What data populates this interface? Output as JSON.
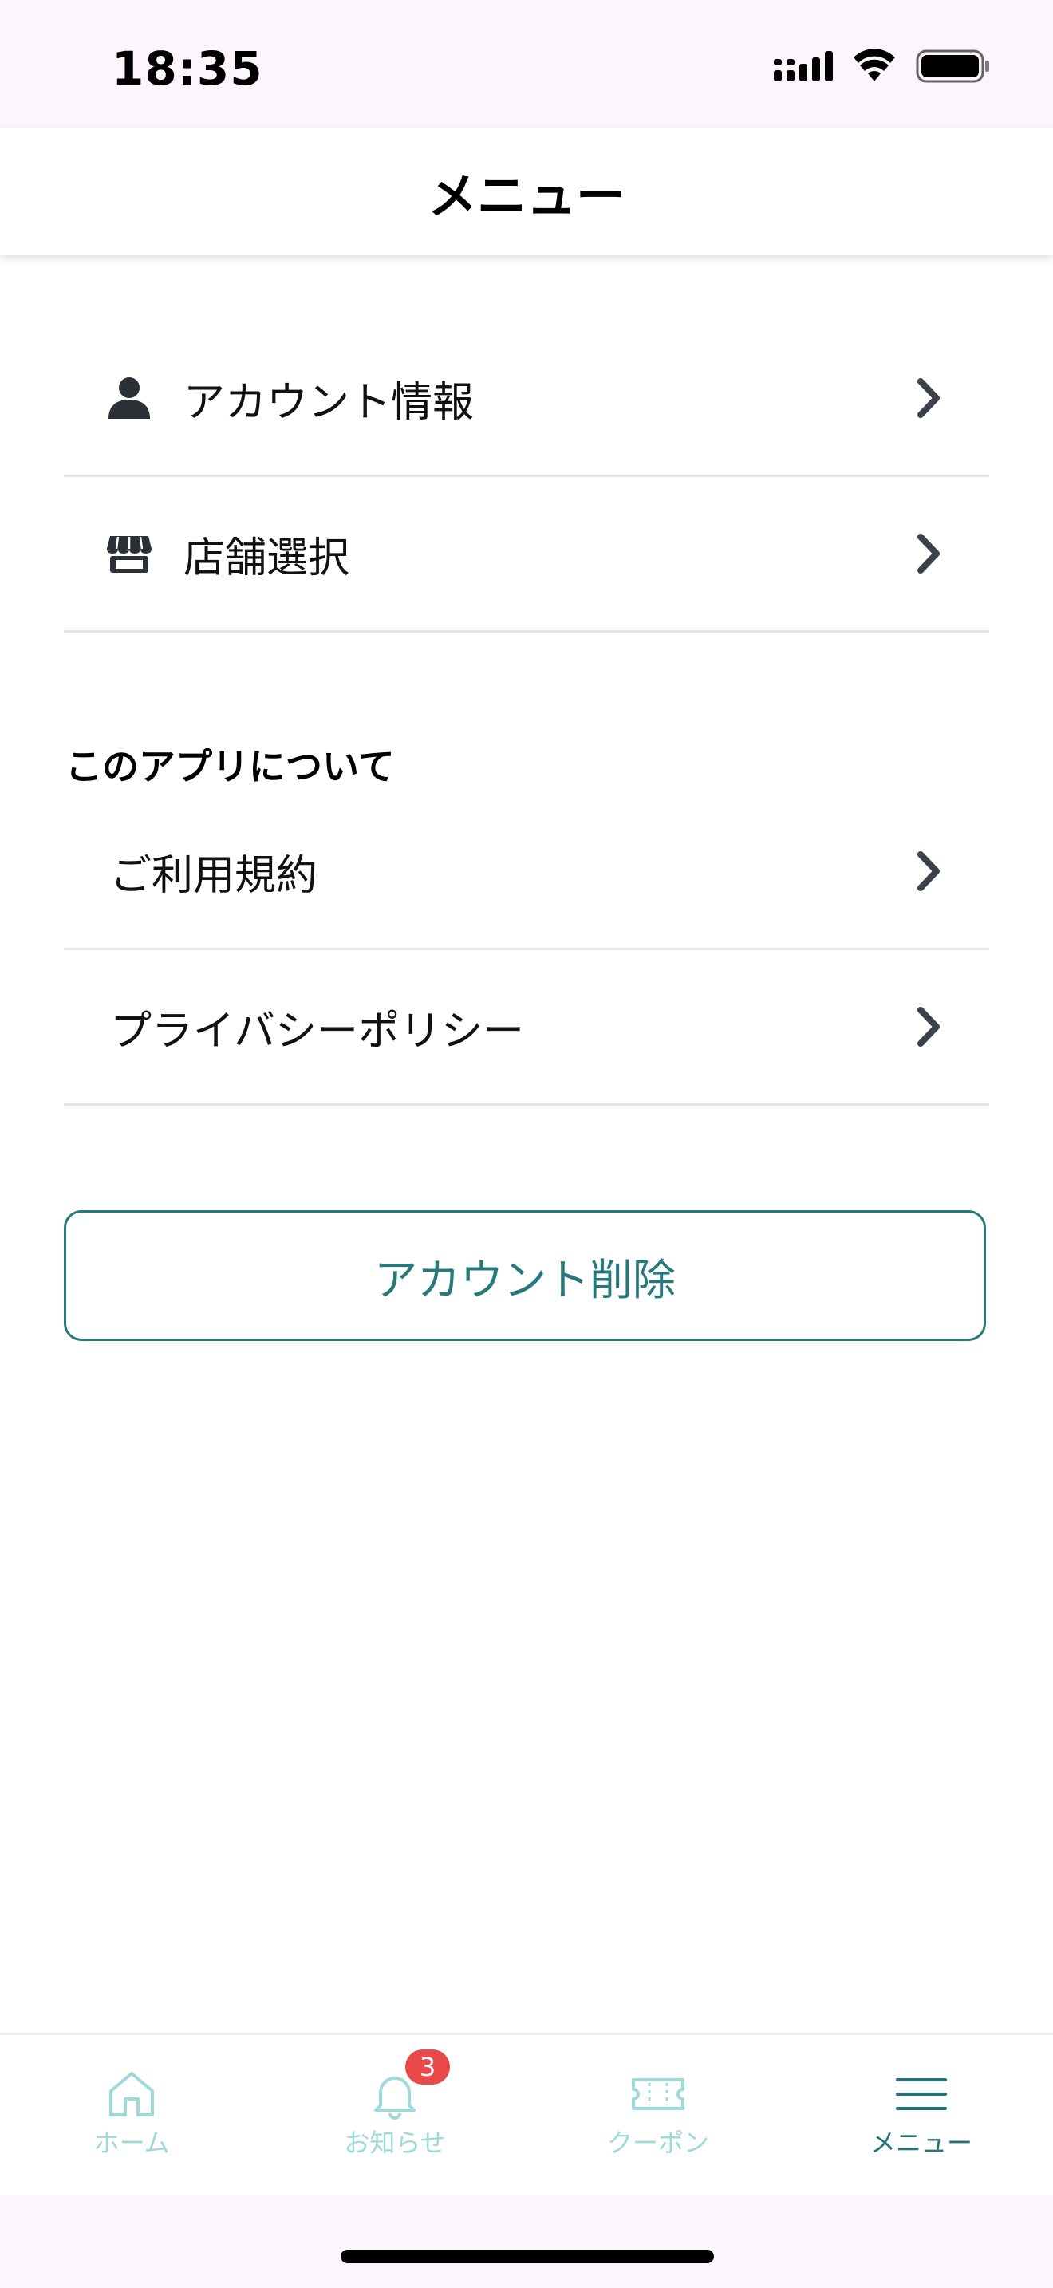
{
  "status_bar": {
    "time": "18:35"
  },
  "header": {
    "title": "メニュー"
  },
  "account_menu": [
    {
      "label": "アカウント情報",
      "icon": "person-icon"
    },
    {
      "label": "店舗選択",
      "icon": "store-icon"
    }
  ],
  "about_section": {
    "title": "このアプリについて",
    "items": [
      {
        "label": "ご利用規約"
      },
      {
        "label": "プライバシーポリシー"
      }
    ]
  },
  "delete_account": {
    "label": "アカウント削除"
  },
  "tabbar": {
    "tabs": [
      {
        "label": "ホーム",
        "icon": "home-icon",
        "active": false
      },
      {
        "label": "お知らせ",
        "icon": "bell-icon",
        "active": false,
        "badge": "3"
      },
      {
        "label": "クーポン",
        "icon": "ticket-icon",
        "active": false
      },
      {
        "label": "メニュー",
        "icon": "hamburger-icon",
        "active": true
      }
    ]
  },
  "colors": {
    "accent": "#27787a",
    "inactive_tab": "#9fdada",
    "badge": "#e84a4a",
    "status_bar_bg": "#fcf6fc"
  }
}
